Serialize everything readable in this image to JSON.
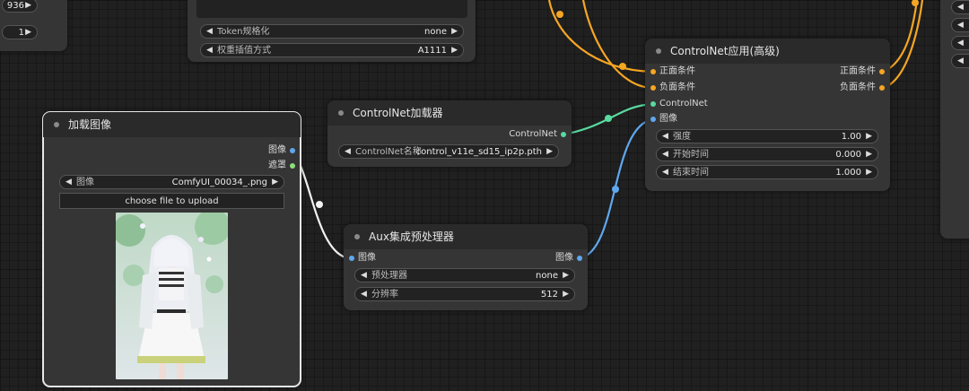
{
  "colors": {
    "cond": "#f5a623",
    "controlnet": "#59d9a0",
    "image": "#5fa8f0",
    "mask": "#8de07a",
    "canvas": "#202020",
    "node": "#353535"
  },
  "topleft": {
    "val1": "936",
    "val2": "1"
  },
  "clip_node": {
    "w_token": {
      "name": "Token规格化",
      "value": "none"
    },
    "w_weight": {
      "name": "权重插值方式",
      "value": "A1111"
    }
  },
  "load_image": {
    "title": "加载图像",
    "out_image": "图像",
    "out_mask": "遮罩",
    "w_image": {
      "name": "图像",
      "value": "ComfyUI_00034_.png"
    },
    "upload_label": "choose file to upload"
  },
  "cn_loader": {
    "title": "ControlNet加载器",
    "out_cn": "ControlNet",
    "w_name": {
      "name": "ControlNet名称",
      "value": "control_v11e_sd15_ip2p.pth"
    }
  },
  "aux": {
    "title": "Aux集成预处理器",
    "in_image": "图像",
    "out_image": "图像",
    "w_pre": {
      "name": "预处理器",
      "value": "none"
    },
    "w_res": {
      "name": "分辨率",
      "value": "512"
    }
  },
  "cn_apply": {
    "title": "ControlNet应用(高级)",
    "in_pos": "正面条件",
    "in_neg": "负面条件",
    "in_cn": "ControlNet",
    "in_image": "图像",
    "out_pos": "正面条件",
    "out_neg": "负面条件",
    "w_strength": {
      "name": "强度",
      "value": "1.00"
    },
    "w_start": {
      "name": "开始时间",
      "value": "0.000"
    },
    "w_end": {
      "name": "结束时间",
      "value": "1.000"
    }
  },
  "arrows": {
    "left": "◀",
    "right": "▶"
  }
}
